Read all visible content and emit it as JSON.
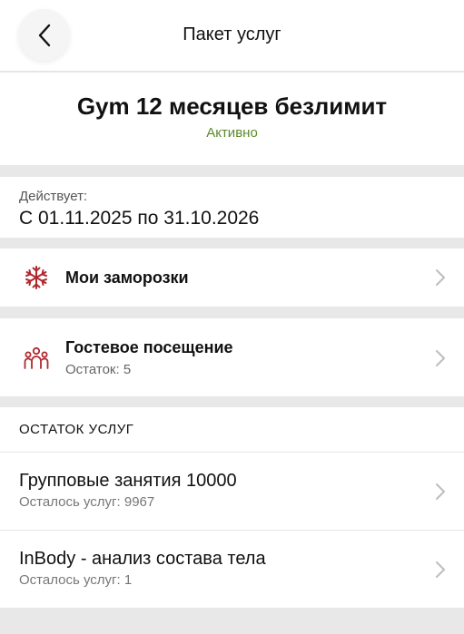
{
  "header": {
    "title": "Пакет услуг",
    "back_icon": "chevron-left-icon"
  },
  "plan": {
    "name": "Gym 12 месяцев безлимит",
    "status": "Активно",
    "status_color": "#5c8a2c"
  },
  "validity": {
    "label": "Действует:",
    "value": "С 01.11.2025 по 31.10.2026"
  },
  "freezes": {
    "label": "Мои заморозки",
    "icon": "snowflake-icon",
    "icon_color": "#b0282e"
  },
  "guest": {
    "label": "Гостевое посещение",
    "remaining": "Остаток: 5",
    "icon": "people-group-icon",
    "icon_color": "#b0282e"
  },
  "services": {
    "section_title": "ОСТАТОК УСЛУГ",
    "items": [
      {
        "title": "Групповые занятия 10000",
        "remaining": "Осталось услуг: 9967"
      },
      {
        "title": "InBody - анализ состава тела",
        "remaining": "Осталось услуг: 1"
      }
    ]
  }
}
